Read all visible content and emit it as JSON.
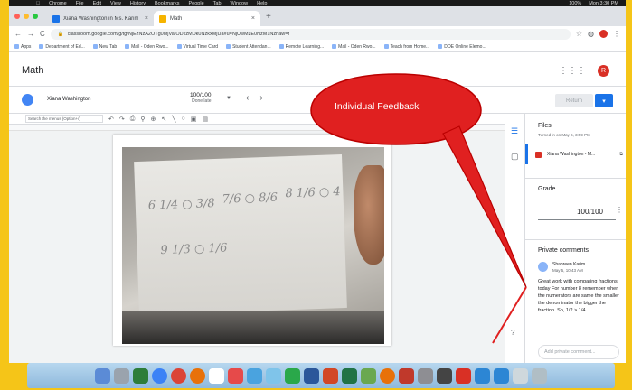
{
  "menubar": {
    "app": "Chrome",
    "items": [
      "File",
      "Edit",
      "View",
      "History",
      "Bookmarks",
      "People",
      "Tab",
      "Window",
      "Help"
    ],
    "status": "100%",
    "time": "Mon 3:30 PM"
  },
  "tabs": [
    {
      "label": "Xiana Washington in Ms. Karim",
      "active": false
    },
    {
      "label": "Math",
      "active": true
    }
  ],
  "address": {
    "url": "classroom.google.com/g/tg/NjEzNzA2OTg0MjVa/ODkzMDk0NzkxMjUa#u=NjUwMzE0NzM1Nzhaw=f"
  },
  "bookmarks": [
    "Apps",
    "Department of Ed...",
    "New Tab",
    "Mail - Oden Rwo...",
    "Virtual Time Card",
    "Student Attendan...",
    "Remote Learning...",
    "Mail - Oden Rwo...",
    "Teach from Home...",
    "DOE Online Elemo..."
  ],
  "classroom": {
    "title": "Math",
    "avatar_letter": "R",
    "student": {
      "name": "Xiana Washington",
      "score": "100/100",
      "status": "Done late"
    },
    "return_label": "Return"
  },
  "doc_toolbar": {
    "search_placeholder": "Search the menus (Option+/)"
  },
  "panel": {
    "files_title": "Files",
    "files_sub": "Turned in on May 6, 3:59 PM",
    "file_name": "Xiana Washington - M...",
    "grade_title": "Grade",
    "grade_value": "100/100",
    "comments_title": "Private comments",
    "commenter": "Shahreen Karim",
    "comment_date": "May 5, 10:43 AM",
    "comment_text": "Great work with comparing fractions today For number 8 remember when the numerators are same the smaller the denominator the bigger the fraction. So, 1/2 > 1/4.",
    "comment_placeholder": "Add private comment..."
  },
  "annotation": {
    "text": "Individual Feedback",
    "color": "#e02020"
  },
  "handwriting": [
    "6 1/4 ○ 3/8",
    "7/6 ○ 8/6",
    "8 1/6 ○ 4",
    "9 1/3 ○ 1/6"
  ]
}
